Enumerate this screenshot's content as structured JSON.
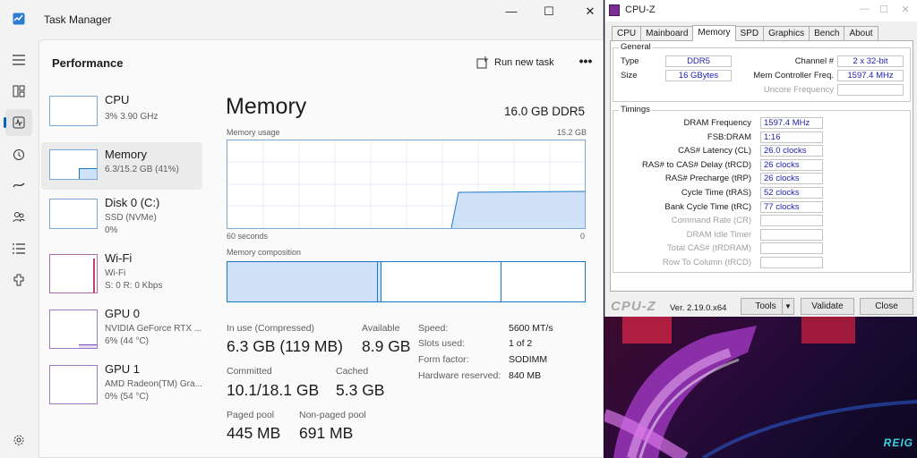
{
  "task_manager": {
    "title": "Task Manager",
    "window_controls": {
      "minimize": "—",
      "maximize": "☐",
      "close": "✕"
    },
    "section_title": "Performance",
    "run_new_task": "Run new task",
    "more": "•••",
    "nav_icons": [
      "hamburger-icon",
      "processes-icon",
      "performance-icon",
      "app-history-icon",
      "startup-apps-icon",
      "users-icon",
      "details-icon",
      "services-icon",
      "settings-icon"
    ],
    "devices": [
      {
        "name": "CPU",
        "sub1": "3%  3.90 GHz",
        "sub2": ""
      },
      {
        "name": "Memory",
        "sub1": "6.3/15.2 GB (41%)",
        "sub2": ""
      },
      {
        "name": "Disk 0 (C:)",
        "sub1": "SSD (NVMe)",
        "sub2": "0%"
      },
      {
        "name": "Wi-Fi",
        "sub1": "Wi-Fi",
        "sub2": "S: 0  R: 0 Kbps"
      },
      {
        "name": "GPU 0",
        "sub1": "NVIDIA GeForce RTX ...",
        "sub2": "6%  (44 °C)"
      },
      {
        "name": "GPU 1",
        "sub1": "AMD Radeon(TM) Gra...",
        "sub2": "0%  (54 °C)"
      }
    ],
    "memory": {
      "title": "Memory",
      "capacity": "16.0 GB DDR5",
      "usage_label": "Memory usage",
      "usage_max": "15.2 GB",
      "time_left": "60 seconds",
      "time_right": "0",
      "composition_label": "Memory composition",
      "in_use_label": "In use (Compressed)",
      "in_use_value": "6.3 GB (119 MB)",
      "available_label": "Available",
      "available_value": "8.9 GB",
      "committed_label": "Committed",
      "committed_value": "10.1/18.1 GB",
      "cached_label": "Cached",
      "cached_value": "5.3 GB",
      "paged_label": "Paged pool",
      "paged_value": "445 MB",
      "nonpaged_label": "Non-paged pool",
      "nonpaged_value": "691 MB",
      "details": [
        {
          "label": "Speed:",
          "value": "5600 MT/s"
        },
        {
          "label": "Slots used:",
          "value": "1 of 2"
        },
        {
          "label": "Form factor:",
          "value": "SODIMM"
        },
        {
          "label": "Hardware reserved:",
          "value": "840 MB"
        }
      ]
    }
  },
  "cpuz": {
    "title": "CPU-Z",
    "tabs": [
      "CPU",
      "Mainboard",
      "Memory",
      "SPD",
      "Graphics",
      "Bench",
      "About"
    ],
    "active_tab": "Memory",
    "general": {
      "title": "General",
      "type_label": "Type",
      "type_value": "DDR5",
      "size_label": "Size",
      "size_value": "16 GBytes",
      "channel_label": "Channel #",
      "channel_value": "2 x 32-bit",
      "mcf_label": "Mem Controller Freq.",
      "mcf_value": "1597.4 MHz",
      "uncore_label": "Uncore Frequency"
    },
    "timings": {
      "title": "Timings",
      "rows": [
        {
          "label": "DRAM Frequency",
          "value": "1597.4 MHz",
          "disabled": false
        },
        {
          "label": "FSB:DRAM",
          "value": "1:16",
          "disabled": false
        },
        {
          "label": "CAS# Latency (CL)",
          "value": "26.0 clocks",
          "disabled": false
        },
        {
          "label": "RAS# to CAS# Delay (tRCD)",
          "value": "26 clocks",
          "disabled": false
        },
        {
          "label": "RAS# Precharge (tRP)",
          "value": "26 clocks",
          "disabled": false
        },
        {
          "label": "Cycle Time (tRAS)",
          "value": "52 clocks",
          "disabled": false
        },
        {
          "label": "Bank Cycle Time (tRC)",
          "value": "77 clocks",
          "disabled": false
        },
        {
          "label": "Command Rate (CR)",
          "value": "",
          "disabled": true
        },
        {
          "label": "DRAM Idle Timer",
          "value": "",
          "disabled": true
        },
        {
          "label": "Total CAS# (tRDRAM)",
          "value": "",
          "disabled": true
        },
        {
          "label": "Row To Column (tRCD)",
          "value": "",
          "disabled": true
        }
      ]
    },
    "logo": "CPU-Z",
    "version": "Ver. 2.19.0.x64",
    "tools": "Tools",
    "validate": "Validate",
    "close": "Close"
  },
  "wallpaper_text": "REIG"
}
